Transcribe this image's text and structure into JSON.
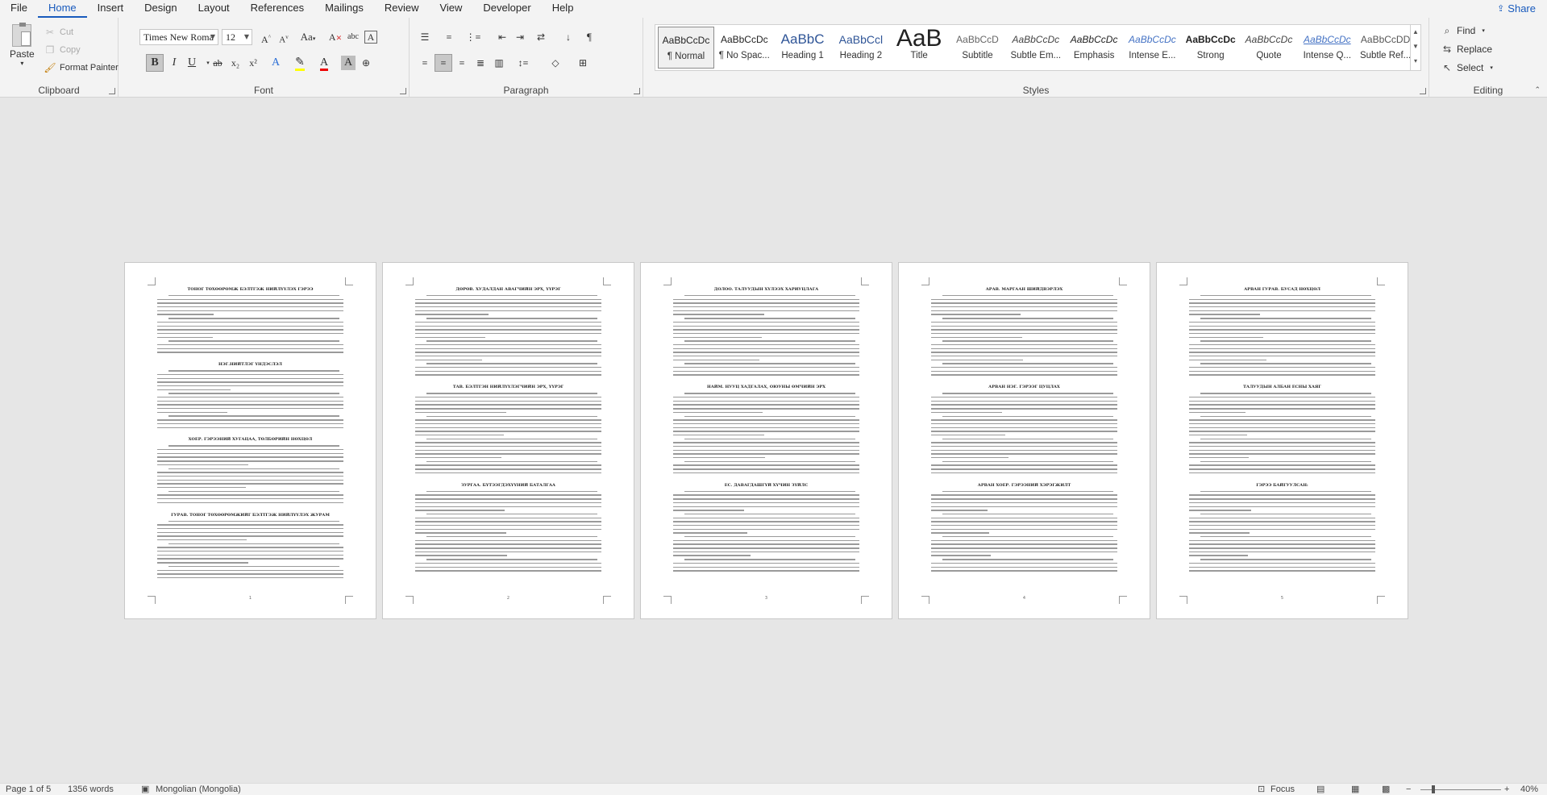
{
  "menu": {
    "tabs": [
      "File",
      "Home",
      "Insert",
      "Design",
      "Layout",
      "References",
      "Mailings",
      "Review",
      "View",
      "Developer",
      "Help"
    ],
    "active_tab": "Home",
    "share_label": "Share"
  },
  "ribbon": {
    "clipboard": {
      "label": "Clipboard",
      "paste": "Paste",
      "cut": "Cut",
      "copy": "Copy",
      "format_painter": "Format Painter"
    },
    "font": {
      "label": "Font",
      "font_name": "Times New Roma",
      "font_size": "12",
      "format_buttons": [
        "B",
        "I",
        "U",
        "ab",
        "x₂",
        "x²"
      ]
    },
    "paragraph": {
      "label": "Paragraph"
    },
    "styles": {
      "label": "Styles",
      "items": [
        {
          "preview": "AaBbCcDc",
          "name": "¶ Normal"
        },
        {
          "preview": "AaBbCcDc",
          "name": "¶ No Spac..."
        },
        {
          "preview": "AaBbC",
          "name": "Heading 1"
        },
        {
          "preview": "AaBbCcl",
          "name": "Heading 2"
        },
        {
          "preview": "AaB",
          "name": "Title"
        },
        {
          "preview": "AaBbCcD",
          "name": "Subtitle"
        },
        {
          "preview": "AaBbCcDc",
          "name": "Subtle Em..."
        },
        {
          "preview": "AaBbCcDc",
          "name": "Emphasis"
        },
        {
          "preview": "AaBbCcDc",
          "name": "Intense E..."
        },
        {
          "preview": "AaBbCcDc",
          "name": "Strong"
        },
        {
          "preview": "AaBbCcDc",
          "name": "Quote"
        },
        {
          "preview": "AaBbCcDc",
          "name": "Intense Q..."
        },
        {
          "preview": "AaBbCcDD",
          "name": "Subtle Ref..."
        }
      ]
    },
    "editing": {
      "label": "Editing",
      "find": "Find",
      "replace": "Replace",
      "select": "Select"
    }
  },
  "pages": [
    {
      "number": "1",
      "headings": [
        "ТОНОГ ТӨХӨӨРӨМЖ БЭЛТГЭЖ НИЙЛҮҮЛЭХ ГЭРЭЭ",
        "НЭГ.НИЙТЛЭГ ҮНДЭСЛЭЛ",
        "ХОЁР. ГЭРЭЭНИЙ ХУГАЦАА, ТӨЛБӨРИЙН НӨХЦӨЛ",
        "ГУРАВ. ТОНОГ ТӨХӨӨРӨМЖИЙГ БЭЛТГЭЖ НИЙЛҮҮЛЭХ ЖУРАМ"
      ]
    },
    {
      "number": "2",
      "headings": [
        "ДӨРӨВ. ХУДАЛДАН АВАГЧИЙН ЭРХ, ҮҮРЭГ",
        "ТАВ. БЭЛТГЭН НИЙЛҮҮЛЭГЧИЙН ЭРХ, ҮҮРЭГ",
        "ЗУРГАА. БҮТЭЭГДЭХҮҮНИЙ БАТАЛГАА"
      ]
    },
    {
      "number": "3",
      "headings": [
        "ДОЛОО. ТАЛУУДЫН ХҮЛЭЭХ ХАРИУЦЛАГА",
        "НАЙМ. НУУЦ ХАДГАЛАХ, ОЮУНЫ ӨМЧИЙН ЭРХ",
        "ЕС. ДАВАГДАШГҮЙ ХҮЧИН ЗҮЙЛС"
      ]
    },
    {
      "number": "4",
      "headings": [
        "АРАВ. МАРГААН ШИЙДВЭРЛЭХ",
        "АРВАН НЭГ. ГЭРЭЭГ ЦУЦЛАХ",
        "АРВАН ХОЁР. ГЭРЭЭНИЙ ХЭРЭГЖИЛТ"
      ]
    },
    {
      "number": "5",
      "headings": [
        "АРВАН ГУРАВ. БУСАД НӨХЦӨЛ",
        "ТАЛУУДЫН АЛБАН ЁСНЫ ХАЯГ",
        "ГЭРЭЭ БАЙГУУЛСАН:"
      ]
    }
  ],
  "status": {
    "page": "Page 1 of 5",
    "words": "1356 words",
    "language": "Mongolian (Mongolia)",
    "focus": "Focus",
    "zoom": "40%"
  }
}
